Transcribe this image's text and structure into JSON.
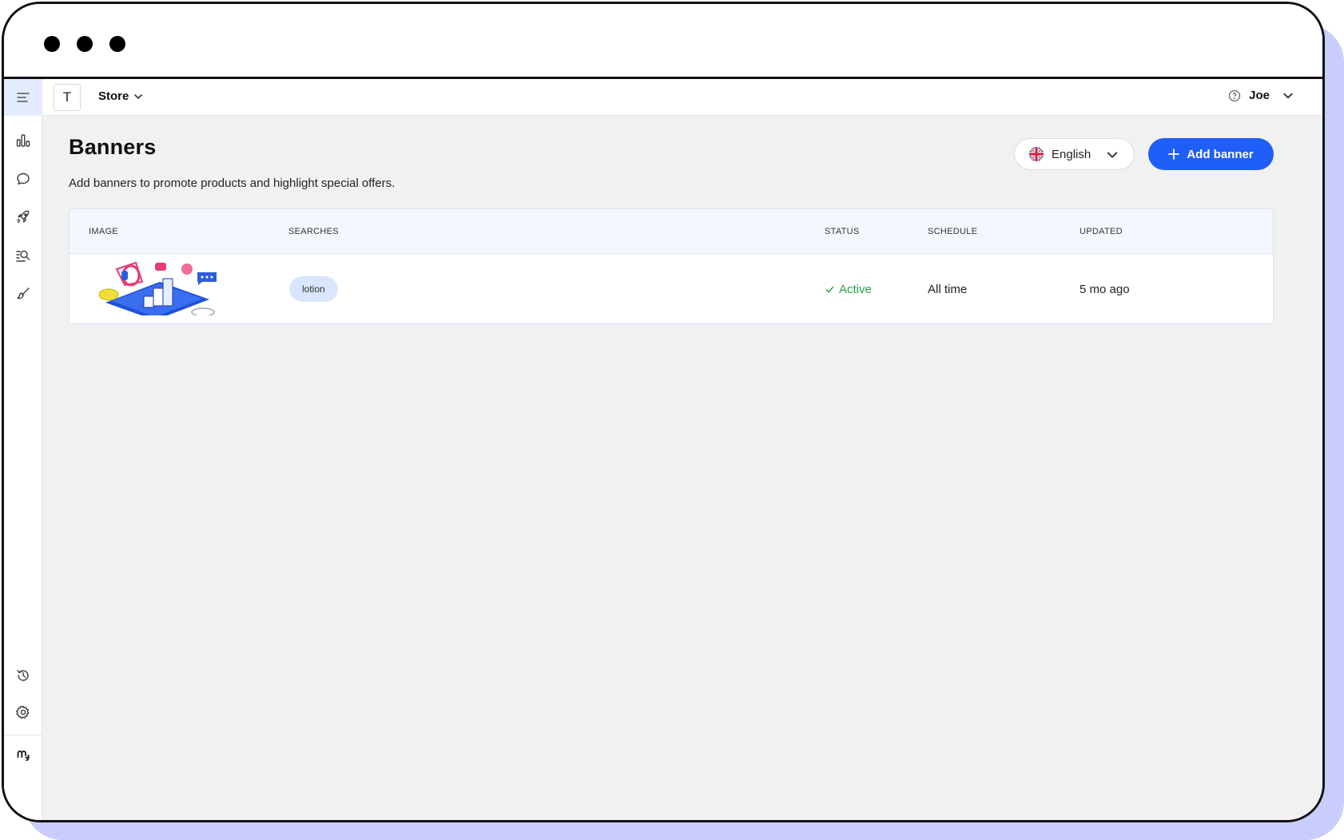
{
  "colors": {
    "accent": "#1f5ef7",
    "status_active": "#28a046",
    "frame_shadow": "#c9cdfb",
    "tag_bg": "#d9e6fd"
  },
  "sidebar": {
    "items": [
      {
        "icon": "menu-icon"
      },
      {
        "icon": "bar-chart-icon"
      },
      {
        "icon": "chat-bubble-icon"
      },
      {
        "icon": "rocket-icon"
      },
      {
        "icon": "search-list-icon"
      },
      {
        "icon": "brush-icon"
      },
      {
        "icon": "history-icon"
      },
      {
        "icon": "gear-icon"
      },
      {
        "icon": "brand-logo-icon"
      }
    ]
  },
  "topbar": {
    "store_initial": "T",
    "store_label": "Store",
    "user_name": "Joe"
  },
  "page": {
    "title": "Banners",
    "subtitle": "Add banners to promote products and highlight special offers."
  },
  "language": {
    "selected": "English",
    "flag": "uk-flag-icon"
  },
  "actions": {
    "add_banner_label": "Add banner"
  },
  "table": {
    "columns": [
      "IMAGE",
      "SEARCHES",
      "STATUS",
      "SCHEDULE",
      "UPDATED"
    ],
    "rows": [
      {
        "image": "banner-thumbnail",
        "searches": "lotion",
        "status": "Active",
        "schedule": "All time",
        "updated": "5 mo ago"
      }
    ]
  }
}
